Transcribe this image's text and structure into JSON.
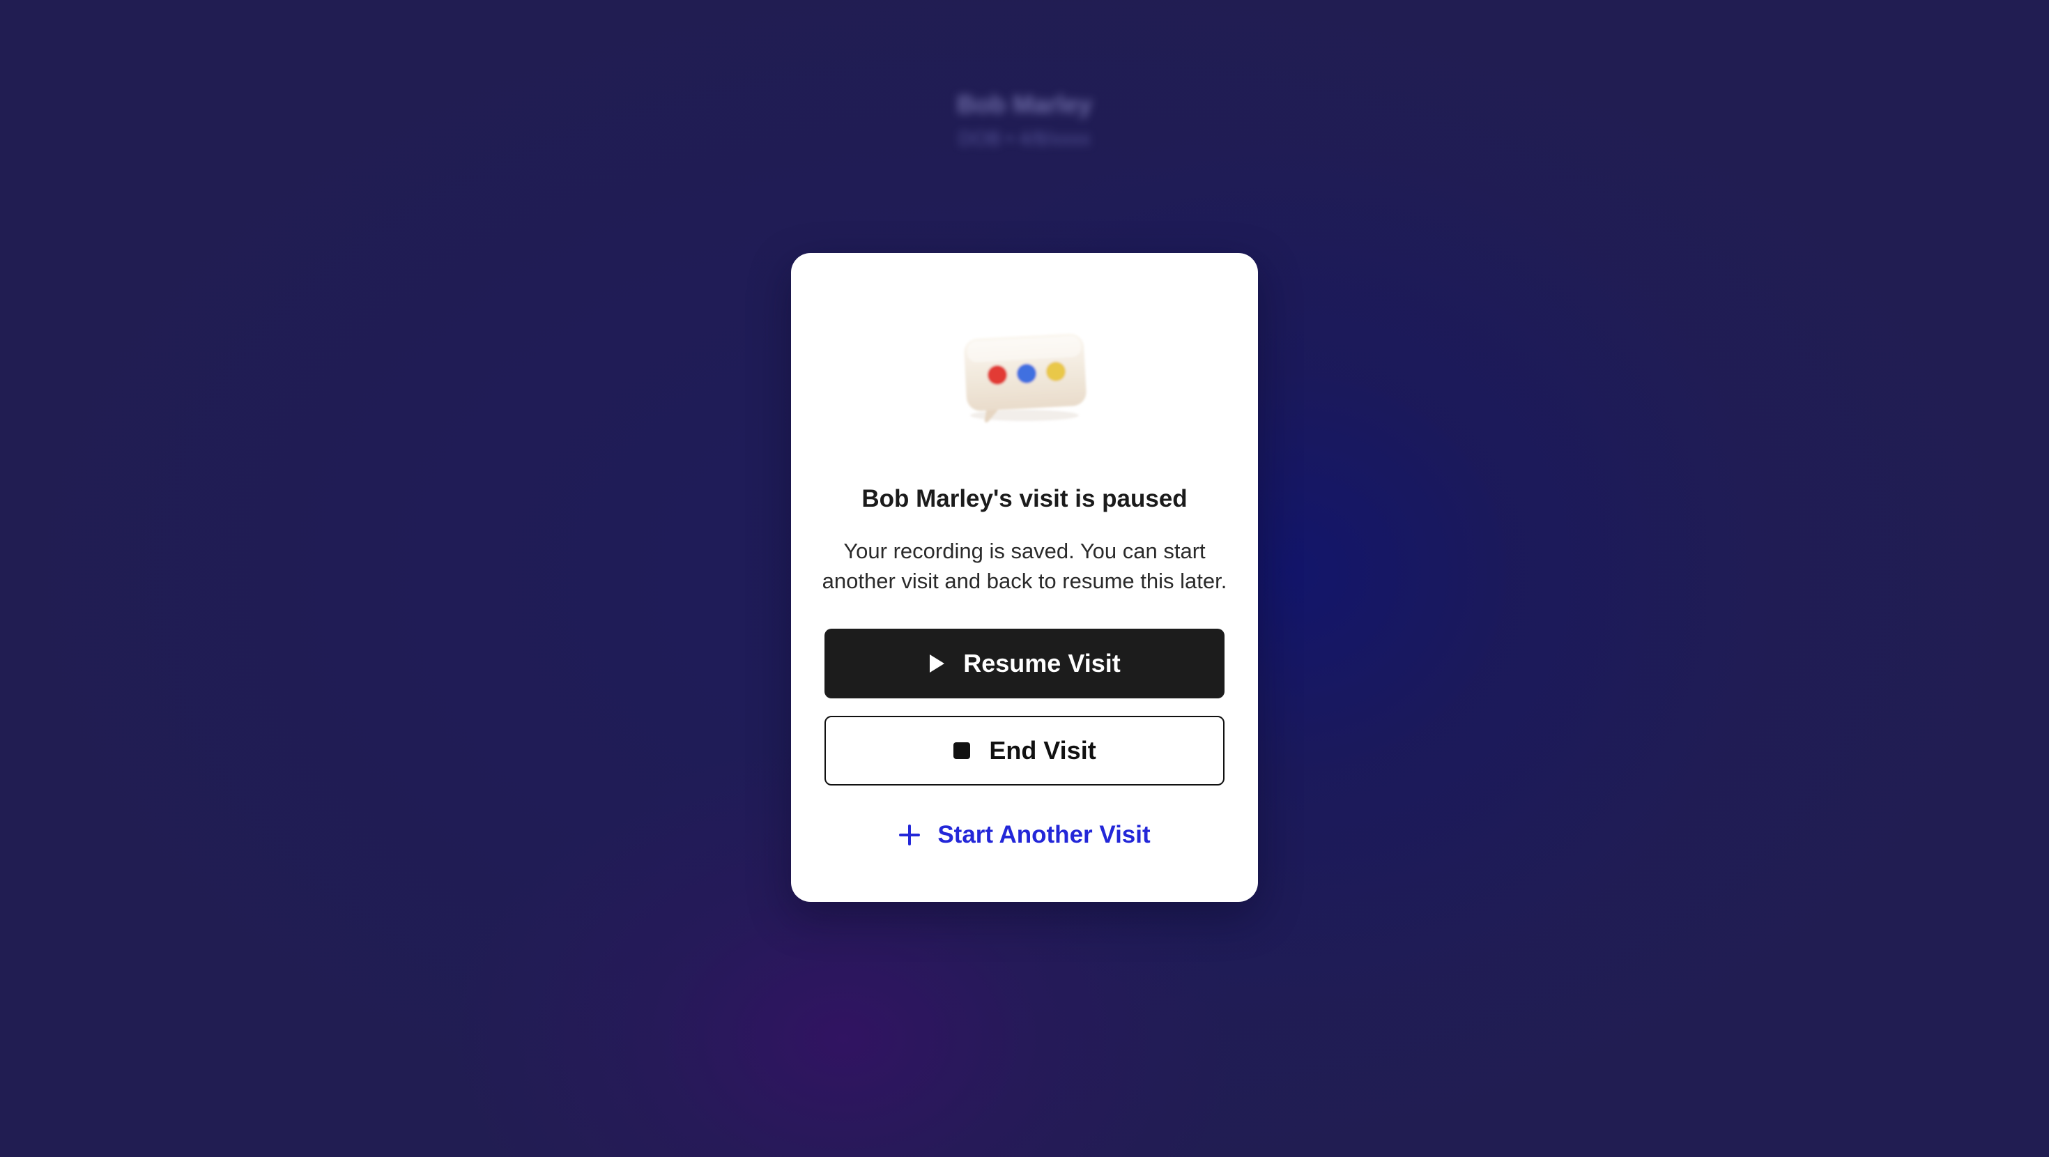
{
  "background_header": {
    "name": "Bob Marley",
    "subtitle": "DOB • 4/8/xxxx"
  },
  "modal": {
    "illustration_icon": "chat-bubble-dots-icon",
    "title": "Bob Marley's visit is paused",
    "description": "Your recording is saved. You can start another visit and back to resume this later.",
    "resume_button": {
      "label": "Resume Visit",
      "icon": "play-icon"
    },
    "end_button": {
      "label": "End Visit",
      "icon": "stop-icon"
    },
    "start_another_link": {
      "label": "Start Another Visit",
      "icon": "plus-icon"
    }
  },
  "colors": {
    "background": "#211d52",
    "card": "#ffffff",
    "primary_button": "#1c1c1c",
    "link": "#2327d8",
    "dot_red": "#e23b35",
    "dot_blue": "#3f6fe0",
    "dot_yellow": "#e9c84a"
  }
}
